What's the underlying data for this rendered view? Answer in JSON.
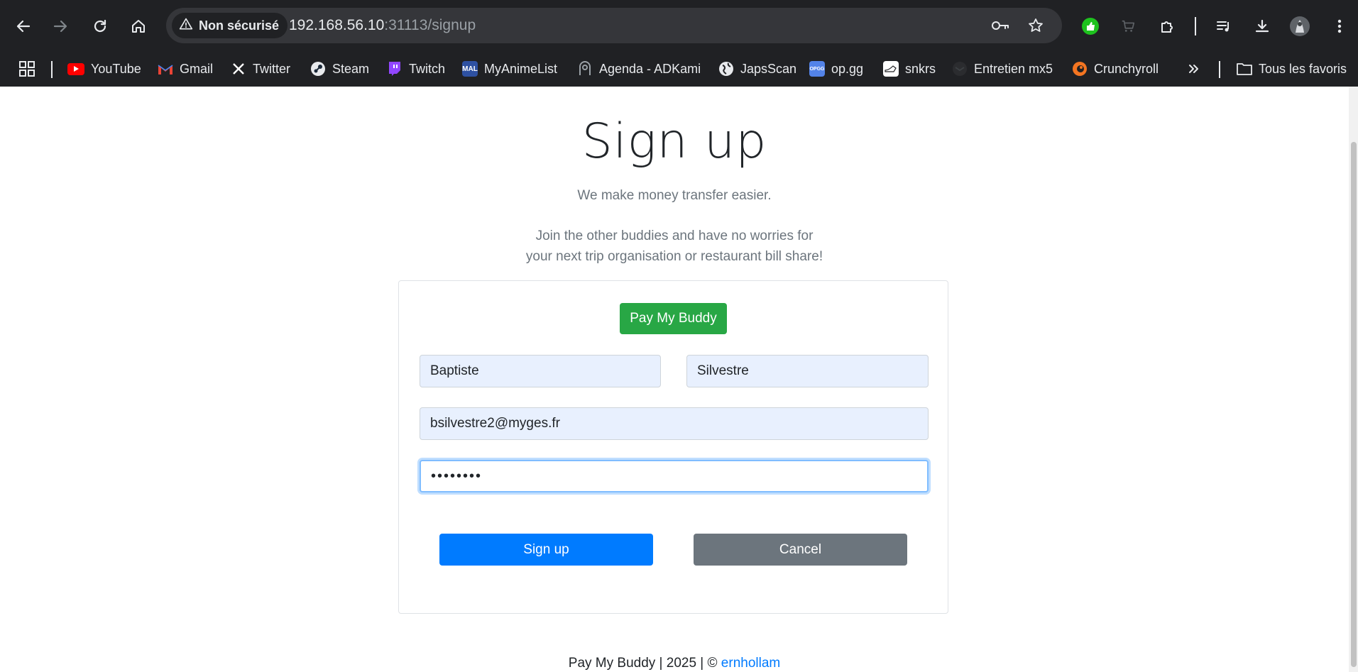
{
  "browser": {
    "security_label": "Non sécurisé",
    "url_host": "192.168.56.10",
    "url_rest": ":31113/signup"
  },
  "bookmarks": [
    {
      "label": "YouTube",
      "icon": "youtube-icon",
      "color": "#ff0000"
    },
    {
      "label": "Gmail",
      "icon": "gmail-icon",
      "color": "#ea4335"
    },
    {
      "label": "Twitter",
      "icon": "x-icon",
      "color": "#ffffff"
    },
    {
      "label": "Steam",
      "icon": "steam-icon",
      "color": "#1b2838"
    },
    {
      "label": "Twitch",
      "icon": "twitch-icon",
      "color": "#9146ff"
    },
    {
      "label": "MyAnimeList",
      "icon": "mal-icon",
      "color": "#2e51a2"
    },
    {
      "label": "Agenda - ADKami",
      "icon": "adkami-icon",
      "color": "#9aa0a6"
    },
    {
      "label": "JapsScan",
      "icon": "globe-icon",
      "color": "#e8eaed"
    },
    {
      "label": "op.gg",
      "icon": "opgg-icon",
      "color": "#5383e8"
    },
    {
      "label": "snkrs",
      "icon": "snkrs-icon",
      "color": "#ffffff"
    },
    {
      "label": "Entretien mx5",
      "icon": "mx5-icon",
      "color": "#3c4043"
    },
    {
      "label": "Crunchyroll",
      "icon": "crunchyroll-icon",
      "color": "#f47521"
    }
  ],
  "all_bookmarks_label": "Tous les favoris",
  "page": {
    "title": "Sign up",
    "tagline": "We make money transfer easier.",
    "description_line1": "Join the other buddies and have no worries for",
    "description_line2": "your next trip organisation or restaurant bill share!",
    "brand_button": "Pay My Buddy",
    "form": {
      "first_name": "Baptiste",
      "last_name": "Silvestre",
      "email": "bsilvestre2@myges.fr",
      "password_mask": "••••••••"
    },
    "signup_button": "Sign up",
    "cancel_button": "Cancel",
    "footer_text": "Pay My Buddy | 2025 | © ",
    "footer_link": "ernhollam"
  },
  "colors": {
    "primary": "#007bff",
    "success": "#28a745",
    "secondary": "#6c757d",
    "autofill_bg": "#e8f0fe"
  }
}
